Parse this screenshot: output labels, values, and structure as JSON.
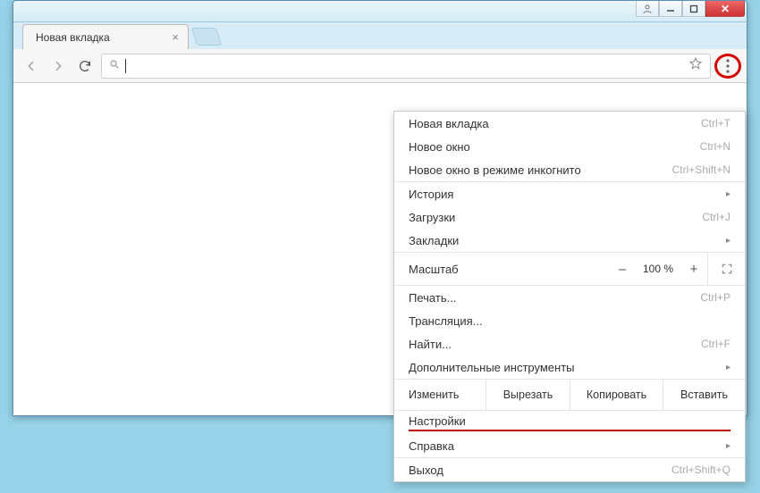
{
  "window": {
    "profile_icon": "person-icon",
    "minimize_icon": "minimize-icon",
    "maximize_icon": "maximize-icon",
    "close_icon": "close-icon"
  },
  "tab": {
    "title": "Новая вкладка",
    "close_icon": "close-icon"
  },
  "toolbar": {
    "back_icon": "arrow-left-icon",
    "forward_icon": "arrow-right-icon",
    "reload_icon": "reload-icon",
    "search_icon": "search-icon",
    "star_icon": "star-icon",
    "menu_icon": "more-vertical-icon",
    "omnibox_value": ""
  },
  "menu": {
    "new_tab": {
      "label": "Новая вкладка",
      "shortcut": "Ctrl+T"
    },
    "new_window": {
      "label": "Новое окно",
      "shortcut": "Ctrl+N"
    },
    "incognito": {
      "label": "Новое окно в режиме инкогнито",
      "shortcut": "Ctrl+Shift+N"
    },
    "history": {
      "label": "История"
    },
    "downloads": {
      "label": "Загрузки",
      "shortcut": "Ctrl+J"
    },
    "bookmarks": {
      "label": "Закладки"
    },
    "zoom": {
      "label": "Масштаб",
      "minus": "–",
      "value": "100 %",
      "plus": "+"
    },
    "print": {
      "label": "Печать...",
      "shortcut": "Ctrl+P"
    },
    "cast": {
      "label": "Трансляция..."
    },
    "find": {
      "label": "Найти...",
      "shortcut": "Ctrl+F"
    },
    "more_tools": {
      "label": "Дополнительные инструменты"
    },
    "edit": {
      "label": "Изменить",
      "cut": "Вырезать",
      "copy": "Копировать",
      "paste": "Вставить"
    },
    "settings": {
      "label": "Настройки"
    },
    "help": {
      "label": "Справка"
    },
    "exit": {
      "label": "Выход",
      "shortcut": "Ctrl+Shift+Q"
    }
  }
}
